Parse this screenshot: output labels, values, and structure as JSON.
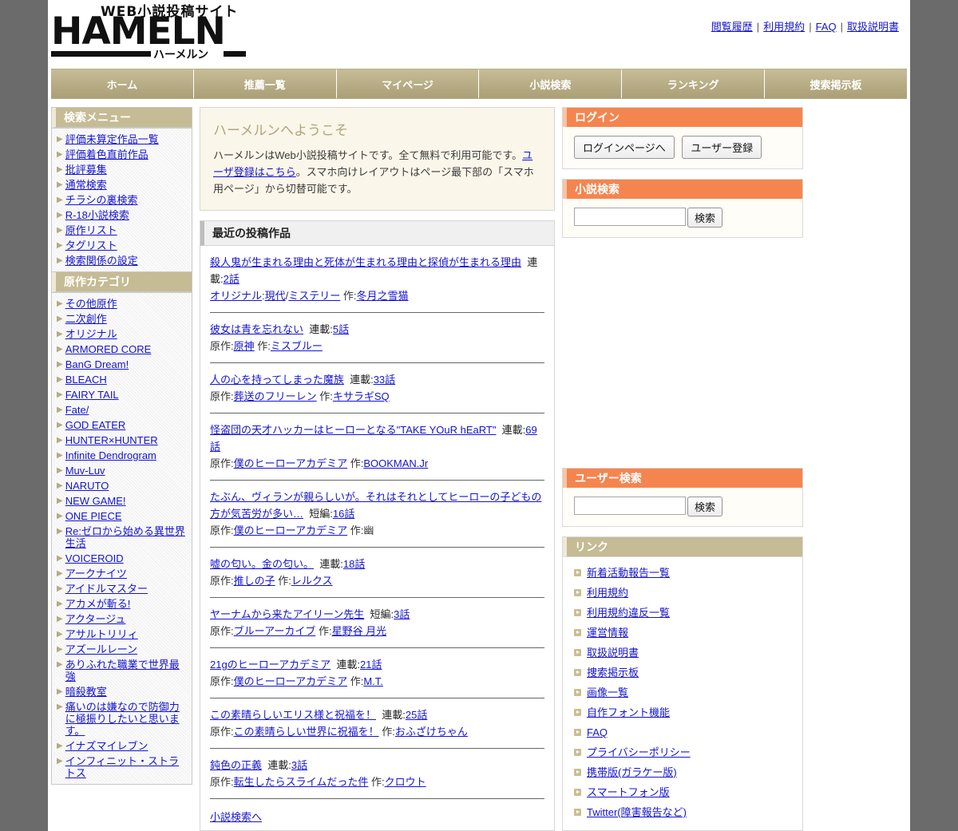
{
  "header": {
    "logo_top": "WEB小説投稿サイト",
    "logo_main": "HAMELN",
    "logo_sub": "ハーメルン",
    "top_links": [
      "閲覧履歴",
      "利用規約",
      "FAQ",
      "取扱説明書"
    ],
    "separator": "|"
  },
  "nav": {
    "items": [
      "ホーム",
      "推薦一覧",
      "マイページ",
      "小説検索",
      "ランキング",
      "捜索掲示板"
    ]
  },
  "sidebar": {
    "search_menu": {
      "title": "検索メニュー",
      "items": [
        "評価未算定作品一覧",
        "評価着色直前作品",
        "批評募集",
        "通常検索",
        "チラシの裏検索",
        "R-18小説検索",
        "原作リスト",
        "タグリスト",
        "検索関係の設定"
      ]
    },
    "category": {
      "title": "原作カテゴリ",
      "items": [
        "その他原作",
        "二次創作",
        "オリジナル",
        "ARMORED CORE",
        "BanG Dream!",
        "BLEACH",
        "FAIRY TAIL",
        "Fate/",
        "GOD EATER",
        "HUNTER×HUNTER",
        "Infinite Dendrogram",
        "Muv-Luv",
        "NARUTO",
        "NEW GAME!",
        "ONE PIECE",
        "Re:ゼロから始める異世界生活",
        "VOICEROID",
        "アークナイツ",
        "アイドルマスター",
        "アカメが斬る!",
        "アクタージュ",
        "アサルトリリィ",
        "アズールレーン",
        "ありふれた職業で世界最強",
        "暗殺教室",
        "痛いのは嫌なので防御力に極振りしたいと思います。",
        "イナズマイレブン",
        "インフィニット・ストラトス"
      ]
    }
  },
  "main": {
    "welcome": {
      "title": "ハーメルンへようこそ",
      "text_1": "ハーメルンはWeb小説投稿サイトです。全て無料で利用可能です。",
      "link_text": "ユーザ登録はこちら",
      "text_2": "。スマホ向けレイアウトはページ最下部の「スマホ用ページ」から切替可能です。"
    },
    "recent": {
      "title": "最近の投稿作品",
      "more_label": "小説検索へ",
      "items": [
        {
          "title": "殺人鬼が生まれる理由と死体が生まれる理由と探偵が生まれる理由",
          "type_label": "連載:",
          "episodes": "2話",
          "origin_label": "オリジナル",
          "genre": "現代",
          "genre2": "ミステリー",
          "author_label": "作:",
          "author": "冬月之雪猫",
          "style": "original"
        },
        {
          "title": "彼女は青を忘れない",
          "type_label": "連載:",
          "episodes": "5話",
          "origin_label": "原作:",
          "origin": "原神",
          "author_label": "作:",
          "author": "ミスブルー",
          "style": "derived"
        },
        {
          "title": "人の心を持ってしまった魔族",
          "type_label": "連載:",
          "episodes": "33話",
          "origin_label": "原作:",
          "origin": "葬送のフリーレン",
          "author_label": "作:",
          "author": "キサラギSQ",
          "style": "derived"
        },
        {
          "title": "怪盗団の天才ハッカーはヒーローとなる\"TAKE YOuR hEaRT\"",
          "type_label": "連載:",
          "episodes": "69話",
          "origin_label": "原作:",
          "origin": "僕のヒーローアカデミア",
          "author_label": "作:",
          "author": "BOOKMAN.Jr",
          "style": "derived"
        },
        {
          "title": "たぶん、ヴィランが親らしいが。それはそれとしてヒーローの子どもの方が気苦労が多い…",
          "type_label": "短編:",
          "episodes": "16話",
          "origin_label": "原作:",
          "origin": "僕のヒーローアカデミア",
          "author_label": "作:",
          "author": "幽",
          "author_is_link": false,
          "style": "derived"
        },
        {
          "title": "嘘の匂い。金の匂い。",
          "type_label": "連載:",
          "episodes": "18話",
          "origin_label": "原作:",
          "origin": "推しの子",
          "author_label": "作:",
          "author": "レルクス",
          "style": "derived"
        },
        {
          "title": "ヤーナムから来たアイリーン先生",
          "type_label": "短編:",
          "episodes": "3話",
          "origin_label": "原作:",
          "origin": "ブルーアーカイブ",
          "author_label": "作:",
          "author": "星野谷 月光",
          "style": "derived"
        },
        {
          "title": "21gのヒーローアカデミア",
          "type_label": "連載:",
          "episodes": "21話",
          "origin_label": "原作:",
          "origin": "僕のヒーローアカデミア",
          "author_label": "作:",
          "author": "M.T.",
          "style": "derived"
        },
        {
          "title": "この素晴らしいエリス様と祝福を！",
          "type_label": "連載:",
          "episodes": "25話",
          "origin_label": "原作:",
          "origin": "この素晴らしい世界に祝福を！",
          "author_label": "作:",
          "author": "おふざけちゃん",
          "style": "derived"
        },
        {
          "title": "鈍色の正義",
          "type_label": "連載:",
          "episodes": "3話",
          "origin_label": "原作:",
          "origin": "転生したらスライムだった件",
          "author_label": "作:",
          "author": "クロウト",
          "style": "derived"
        }
      ]
    }
  },
  "right": {
    "login": {
      "title": "ログイン",
      "login_button": "ログインページへ",
      "register_button": "ユーザー登録"
    },
    "novel_search": {
      "title": "小説検索",
      "input_value": "",
      "placeholder": "",
      "button": "検索"
    },
    "user_search": {
      "title": "ユーザー検索",
      "input_value": "",
      "placeholder": "",
      "button": "検索"
    },
    "links": {
      "title": "リンク",
      "items": [
        "新着活動報告一覧",
        "利用規約",
        "利用規約違反一覧",
        "運営情報",
        "取扱説明書",
        "捜索掲示板",
        "画像一覧",
        "自作フォント機能",
        "FAQ",
        "プライバシーポリシー",
        "携帯版(ガラケー版)",
        "スマートフォン版",
        "Twitter(障害報告など)"
      ]
    }
  },
  "colors": {
    "nav_bg": "#b6ab84",
    "panel_tan": "#c5bb94",
    "panel_orange": "#f5854f",
    "link_blue": "#1414d2",
    "welcome_bg": "#faf6e9",
    "page_bg": "#6b6b6b"
  }
}
